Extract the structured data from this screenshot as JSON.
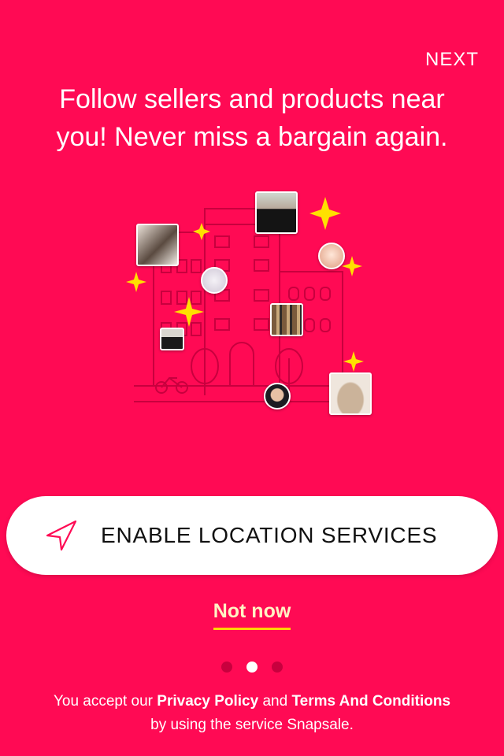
{
  "header": {
    "next_label": "NEXT"
  },
  "onboarding": {
    "headline_line1": "Follow sellers and products near",
    "headline_line2": "you! Never miss a bargain again.",
    "pager_active_index": 2,
    "pager_count": 3
  },
  "cta": {
    "label": "ENABLE LOCATION SERVICES",
    "icon": "location-arrow-icon"
  },
  "secondary": {
    "not_now_label": "Not now"
  },
  "legal": {
    "prefix": "You accept our",
    "privacy_link": "Privacy Policy",
    "and": "and",
    "terms_link": "Terms And Conditions",
    "suffix": "by using the service Snapsale."
  },
  "colors": {
    "background": "#FF0A54",
    "accent_yellow": "#FFD400",
    "line_art": "#C8003E",
    "button_bg": "#FFFFFF"
  }
}
